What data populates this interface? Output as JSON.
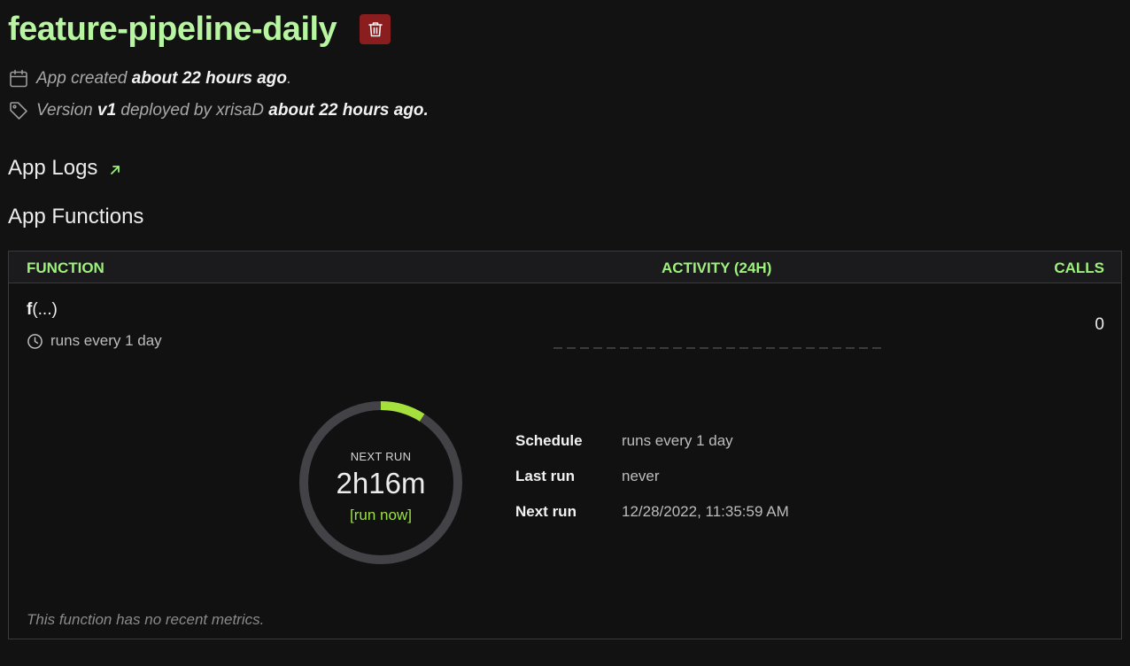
{
  "header": {
    "title": "feature-pipeline-daily",
    "delete_icon": "trash-icon"
  },
  "meta": {
    "created_prefix": "App created",
    "created_time": "about 22 hours ago",
    "created_suffix": ".",
    "version_prefix": "Version",
    "version": "v1",
    "deployed_by": "deployed by xrisaD",
    "deployed_time": "about 22 hours ago."
  },
  "sections": {
    "logs_label": "App Logs",
    "functions_label": "App Functions"
  },
  "table": {
    "headers": {
      "function": "FUNCTION",
      "activity": "ACTIVITY (24H)",
      "calls": "CALLS"
    },
    "row": {
      "name_bold": "f",
      "name_args": "(...)",
      "schedule": "runs every 1 day",
      "calls": "0"
    }
  },
  "next_run": {
    "label": "NEXT RUN",
    "time": "2h16m",
    "run_now": "[run now]",
    "progress_fraction": 0.09
  },
  "details": {
    "schedule_label": "Schedule",
    "schedule_value": "runs every 1 day",
    "last_run_label": "Last run",
    "last_run_value": "never",
    "next_run_label": "Next run",
    "next_run_value": "12/28/2022, 11:35:59 AM"
  },
  "footer": {
    "no_metrics": "This function has no recent metrics."
  },
  "colors": {
    "accent": "#b7f5a0",
    "header_green": "#9ef27c",
    "progress": "#a6e03d",
    "delete_bg": "#8a1d1d"
  }
}
